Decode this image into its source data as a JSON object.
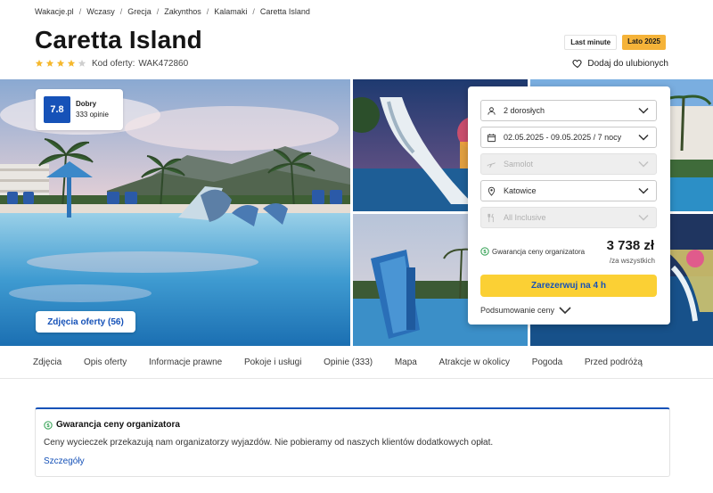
{
  "breadcrumb": [
    "Wakacje.pl",
    "Wczasy",
    "Grecja",
    "Zakynthos",
    "Kalamaki",
    "Caretta Island"
  ],
  "breadcrumb_separator": "/",
  "hotel": {
    "title": "Caretta Island",
    "stars": 4,
    "max_stars": 5,
    "offer_code_label": "Kod oferty:",
    "offer_code": "WAK472860"
  },
  "badges": {
    "last_minute": "Last minute",
    "summer": "Lato 2025"
  },
  "favorite_label": "Dodaj do ulubionych",
  "rating": {
    "score": "7.8",
    "label": "Dobry",
    "count": "333 opinie"
  },
  "photos_button": "Zdjęcia oferty (56)",
  "booking": {
    "guests": "2 dorosłych",
    "dates": "02.05.2025 - 09.05.2025 / 7 nocy",
    "transport": "Samolot",
    "departure": "Katowice",
    "board": "All Inclusive",
    "guarantee": "Gwarancja ceny organizatora",
    "price": "3 738 zł",
    "price_note": "/za wszystkich",
    "reserve_button": "Zarezerwuj na 4 h",
    "summary": "Podsumowanie ceny"
  },
  "tabs": [
    "Zdjęcia",
    "Opis oferty",
    "Informacje prawne",
    "Pokoje i usługi",
    "Opinie (333)",
    "Mapa",
    "Atrakcje w okolicy",
    "Pogoda",
    "Przed podróżą"
  ],
  "info": {
    "title": "Gwarancja ceny organizatora",
    "description": "Ceny wycieczek przekazują nam organizatorzy wyjazdów. Nie pobieramy od naszych klientów dodatkowych opłat.",
    "link": "Szczegóły"
  },
  "colors": {
    "brand_blue": "#1652b8",
    "reserve_yellow": "#fbd034",
    "badge_orange": "#f5b339",
    "guarantee_green": "#2e9e4f",
    "star_yellow": "#f5b82e",
    "star_empty": "#cfcfcf"
  },
  "icons": {
    "guests": "user-icon",
    "dates": "calendar-icon",
    "transport": "plane-icon",
    "departure": "location-pin-icon",
    "board": "cutlery-icon",
    "favorite": "heart-icon",
    "guarantee": "dollar-circle-icon",
    "dropdown": "chevron-down-icon"
  }
}
